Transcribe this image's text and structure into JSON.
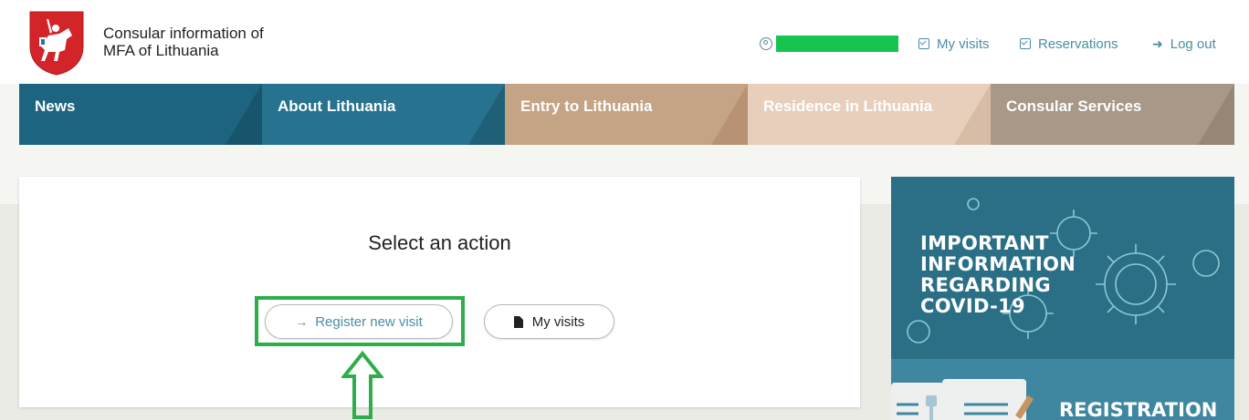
{
  "header": {
    "site_title_line1": "Consular information of",
    "site_title_line2": "MFA of Lithuania",
    "links": {
      "my_visits": "My visits",
      "reservations": "Reservations",
      "log_out": "Log out"
    },
    "icons": [
      "user-icon",
      "calendar-check-icon",
      "calendar-check-icon",
      "sign-out-icon"
    ]
  },
  "nav": {
    "tabs": [
      {
        "label": "News",
        "color": "#1d6480"
      },
      {
        "label": "About Lithuania",
        "color": "#26728f"
      },
      {
        "label": "Entry to Lithuania",
        "color": "#c5a385"
      },
      {
        "label": "Residence in Lithuania",
        "color": "#e7cfbc"
      },
      {
        "label": "Consular Services",
        "color": "#a79888"
      }
    ]
  },
  "main": {
    "title": "Select an action",
    "register_button": "Register new visit",
    "my_visits_button": "My visits",
    "highlight_color": "#2eae4a"
  },
  "sidebar": {
    "covid_banner": [
      "IMPORTANT",
      "INFORMATION",
      "REGARDING",
      "COVID-19"
    ],
    "registration_banner": "REGISTRATION"
  }
}
